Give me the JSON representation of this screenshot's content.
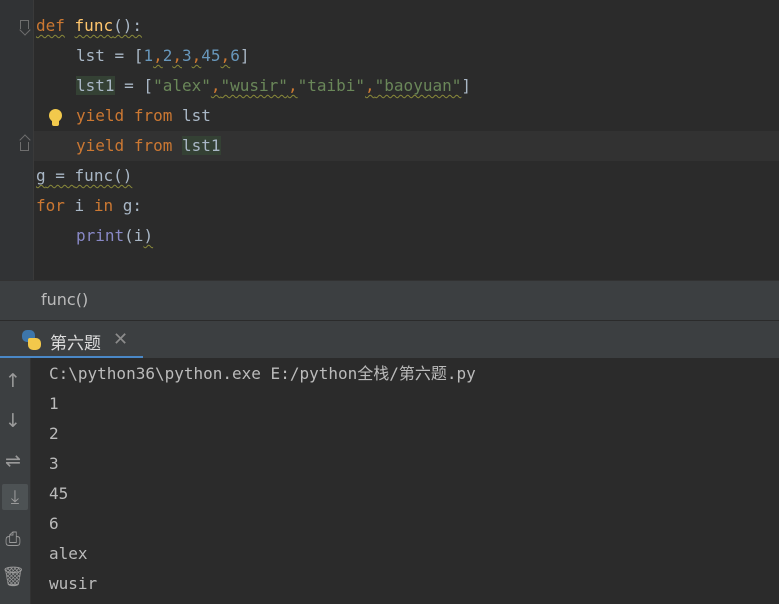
{
  "editor": {
    "code": {
      "l1_kw": "def",
      "l1_fn": "func",
      "l1_rest": "():",
      "l2_a": "lst = [",
      "l2_n1": "1",
      "l2_n2": "2",
      "l2_n3": "3",
      "l2_n4": "45",
      "l2_n5": "6",
      "l2_end": "]",
      "l3_a": "lst1",
      "l3_b": " = [",
      "l3_s1": "\"alex\"",
      "l3_s2": "\"wusir\"",
      "l3_s3": "\"taibi\"",
      "l3_s4": "\"baoyuan\"",
      "l3_end": "]",
      "l4_kw1": "yield",
      "l4_kw2": "from",
      "l4_var": "lst",
      "l5_kw1": "yield",
      "l5_kw2": "from",
      "l5_var": "lst1",
      "l6_a": "g",
      "l6_b": " = ",
      "l6_c": "func()",
      "l7_kw1": "for",
      "l7_v": " i ",
      "l7_kw2": "in",
      "l7_rest": " g:",
      "l8_bi": "print",
      "l8_a": "(i",
      "l8_b": ")"
    },
    "colors": {
      "keyword": "#cc7832",
      "function": "#ffc66d",
      "number": "#6897bb",
      "string": "#6a8759",
      "builtin": "#8888c6"
    }
  },
  "breadcrumb": {
    "label": "func()"
  },
  "run": {
    "tab_label": "第六题",
    "tab_close": "✕",
    "toolbar_icons": [
      "arrow-up-icon",
      "arrow-down-icon",
      "soft-wrap-icon",
      "scroll-to-end-icon",
      "print-icon",
      "trash-icon"
    ],
    "output": [
      "C:\\python36\\python.exe E:/python全栈/第六题.py",
      "1",
      "2",
      "3",
      "45",
      "6",
      "alex",
      "wusir"
    ]
  }
}
